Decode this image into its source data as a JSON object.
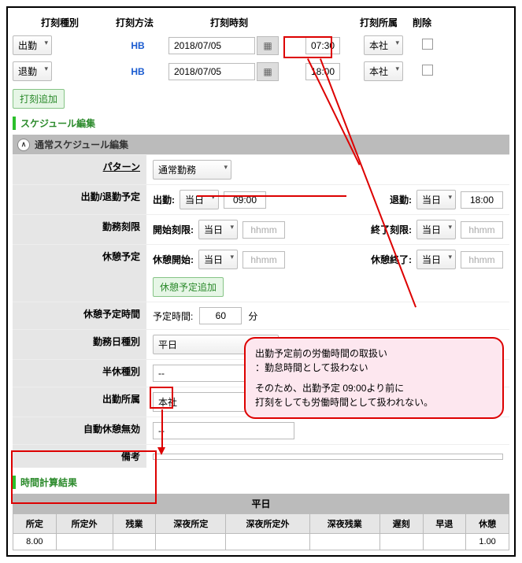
{
  "timestamps": {
    "headers": [
      "打刻種別",
      "打刻方法",
      "打刻時刻",
      "打刻所属",
      "削除"
    ],
    "rows": [
      {
        "type": "出勤",
        "method": "HB",
        "date": "2018/07/05",
        "time": "07:30",
        "loc": "本社"
      },
      {
        "type": "退勤",
        "method": "HB",
        "date": "2018/07/05",
        "time": "18:00",
        "loc": "本社"
      }
    ],
    "add_btn": "打刻追加"
  },
  "sections": {
    "schedule": "スケジュール編集",
    "schedule_panel": "通常スケジュール編集",
    "calc": "時間計算結果"
  },
  "sched": {
    "pattern_lbl": "パターン",
    "pattern_val": "通常勤務",
    "inout_lbl": "出勤/退勤予定",
    "in_cap": "出勤:",
    "out_cap": "退勤:",
    "day_opt": "当日",
    "in_time": "09:00",
    "out_time": "18:00",
    "limit_lbl": "勤務刻限",
    "start_cap": "開始刻限:",
    "end_cap": "終了刻限:",
    "ph": "hhmm",
    "break_lbl": "休憩予定",
    "break_start_cap": "休憩開始:",
    "break_end_cap": "休憩終了:",
    "break_add": "休憩予定追加",
    "break_time_lbl": "休憩予定時間",
    "break_time_cap": "予定時間:",
    "break_time_val": "60",
    "min": "分",
    "daytype_lbl": "勤務日種別",
    "daytype_val": "平日",
    "half_lbl": "半休種別",
    "half_val": "--",
    "loc_lbl": "出勤所属",
    "loc_val": "本社",
    "autobrk_lbl": "自動休憩無効",
    "autobrk_val": "--",
    "memo_lbl": "備考"
  },
  "results": {
    "title": "平日",
    "cols": [
      "所定",
      "所定外",
      "残業",
      "深夜所定",
      "深夜所定外",
      "深夜残業",
      "遅刻",
      "早退",
      "休憩"
    ],
    "vals": [
      "8.00",
      "",
      "",
      "",
      "",
      "",
      "",
      "",
      "1.00"
    ]
  },
  "callout": {
    "l1": "出勤予定前の労働時間の取扱い",
    "l2": "：勤怠時間として扱わない",
    "l3": "そのため、出勤予定 09:00より前に",
    "l4": "打刻をしても労働時間として扱われない。"
  }
}
